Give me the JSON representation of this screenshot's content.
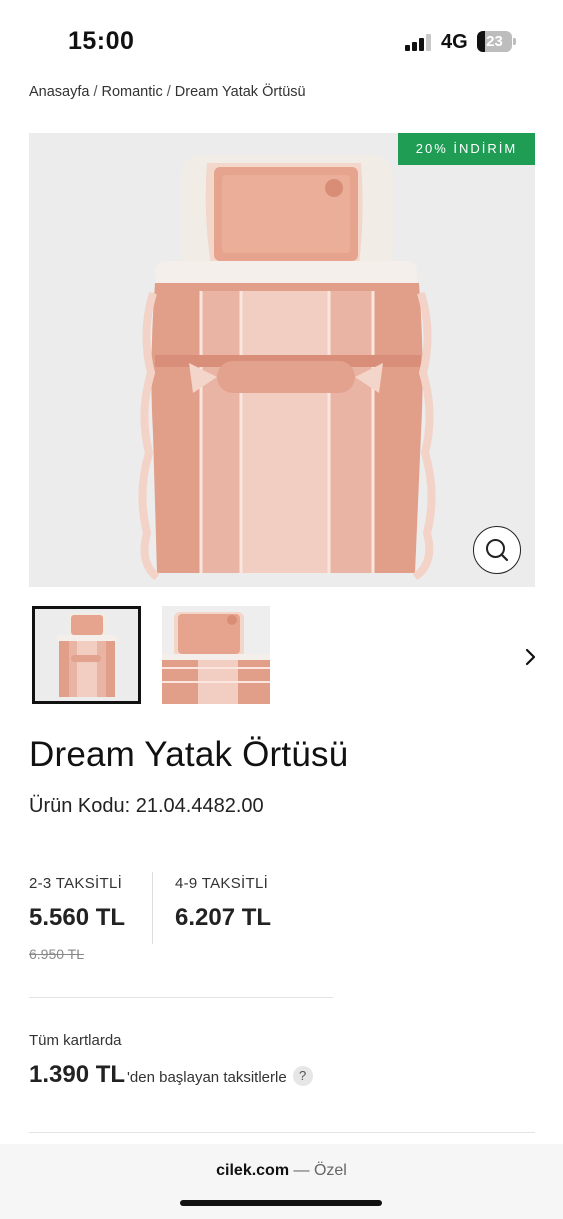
{
  "status": {
    "time": "15:00",
    "network": "4G",
    "battery": "23",
    "battery_level": 0.23
  },
  "breadcrumb": {
    "items": [
      "Anasayfa",
      "Romantic",
      "Dream Yatak Örtüsü"
    ],
    "separator": "/"
  },
  "gallery": {
    "badge": "20% İNDİRİM",
    "badge_color": "#1f9d55",
    "zoom_icon": "search-icon",
    "next_icon": "chevron-right-icon"
  },
  "product": {
    "title": "Dream Yatak Örtüsü",
    "code": "Ürün Kodu: 21.04.4482.00"
  },
  "pricing": {
    "plan_1": {
      "label": "2-3 TAKSİTLİ",
      "price": "5.560 TL"
    },
    "plan_2": {
      "label": "4-9 TAKSİTLİ",
      "price": "6.207 TL"
    },
    "old_price": "6.950 TL"
  },
  "installment": {
    "label": "Tüm kartlarda",
    "amount": "1.390 TL",
    "text": "'den başlayan taksitlerle",
    "help": "?"
  },
  "browser": {
    "domain": "cilek.com",
    "suffix": " — Özel"
  }
}
